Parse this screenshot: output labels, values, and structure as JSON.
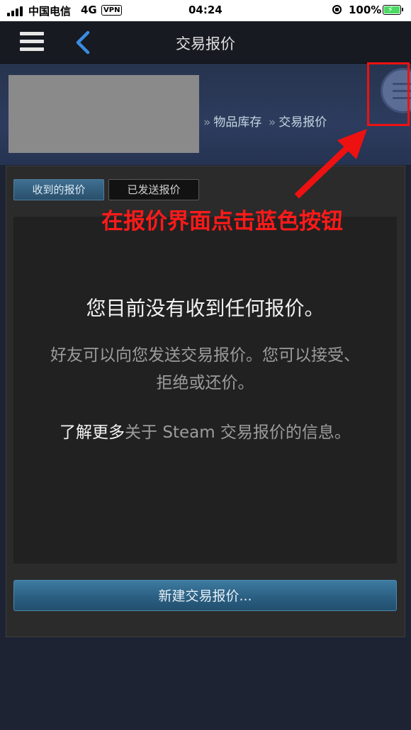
{
  "status_bar": {
    "carrier": "中国电信",
    "network": "4G",
    "vpn": "VPN",
    "time": "04:24",
    "battery": "100%"
  },
  "nav": {
    "title": "交易报价"
  },
  "breadcrumb": {
    "sep1": "»",
    "item1": "物品库存",
    "sep2": "»",
    "item2": "交易报价"
  },
  "tabs": {
    "received": "收到的报价",
    "sent": "已发送报价"
  },
  "message": {
    "title": "您目前没有收到任何报价。",
    "body": "好友可以向您发送交易报价。您可以接受、拒绝或还价。",
    "learn_more_link": "了解更多",
    "learn_more_rest": "关于 Steam 交易报价的信息。"
  },
  "new_offer_button": "新建交易报价...",
  "annotation": {
    "text": "在报价界面点击蓝色按钮",
    "color": "#ff1a1a"
  },
  "colors": {
    "accent_blue": "#2a5d80",
    "background": "#1d2333",
    "panel": "#2b2b2b"
  }
}
